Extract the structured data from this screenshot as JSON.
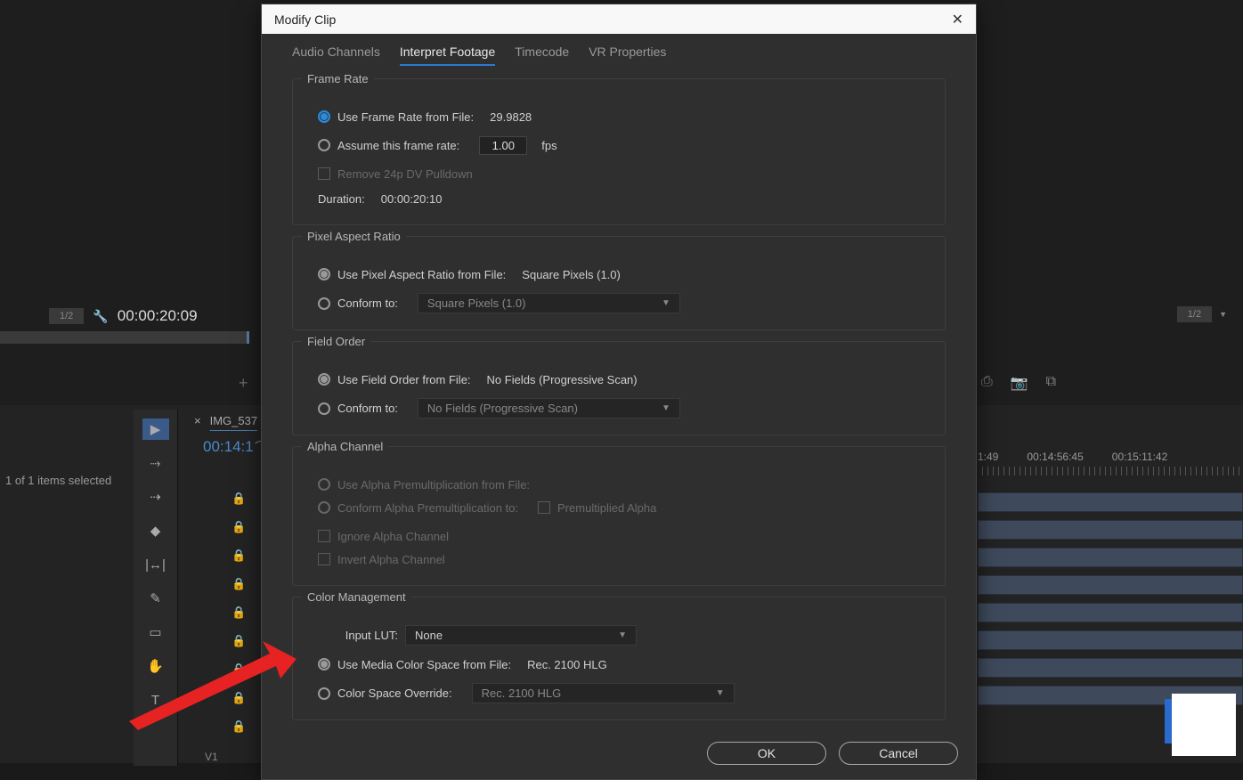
{
  "modal": {
    "title": "Modify Clip",
    "tabs": [
      "Audio Channels",
      "Interpret Footage",
      "Timecode",
      "VR Properties"
    ],
    "active_tab": 1,
    "frame_rate": {
      "legend": "Frame Rate",
      "use_from_file_label": "Use Frame Rate from File:",
      "use_from_file_value": "29.9828",
      "assume_label": "Assume this frame rate:",
      "assume_value": "1.00",
      "assume_unit": "fps",
      "remove_pulldown": "Remove 24p DV Pulldown",
      "duration_label": "Duration:",
      "duration_value": "00:00:20:10"
    },
    "par": {
      "legend": "Pixel Aspect Ratio",
      "use_label": "Use Pixel Aspect Ratio from File:",
      "use_value": "Square Pixels (1.0)",
      "conform_label": "Conform to:",
      "conform_value": "Square Pixels (1.0)"
    },
    "field": {
      "legend": "Field Order",
      "use_label": "Use Field Order from File:",
      "use_value": "No Fields (Progressive Scan)",
      "conform_label": "Conform to:",
      "conform_value": "No Fields (Progressive Scan)"
    },
    "alpha": {
      "legend": "Alpha Channel",
      "use_label": "Use Alpha Premultiplication from File:",
      "conform_label": "Conform Alpha Premultiplication to:",
      "premult": "Premultiplied Alpha",
      "ignore": "Ignore Alpha Channel",
      "invert": "Invert Alpha Channel"
    },
    "color": {
      "legend": "Color Management",
      "lut_label": "Input LUT:",
      "lut_value": "None",
      "use_label": "Use Media Color Space from File:",
      "use_value": "Rec. 2100 HLG",
      "override_label": "Color Space Override:",
      "override_value": "Rec. 2100 HLG"
    },
    "ok": "OK",
    "cancel": "Cancel"
  },
  "bg": {
    "left_sel": "1/2",
    "left_tc": "00:00:20:09",
    "right_sel": "1/2",
    "items_status": "1 of 1 items selected",
    "tl_name": "IMG_537",
    "tl_tc": "00:14:1",
    "track_label": "V1",
    "ruler": [
      "1:49",
      "00:14:56:45",
      "00:15:11:42"
    ]
  }
}
